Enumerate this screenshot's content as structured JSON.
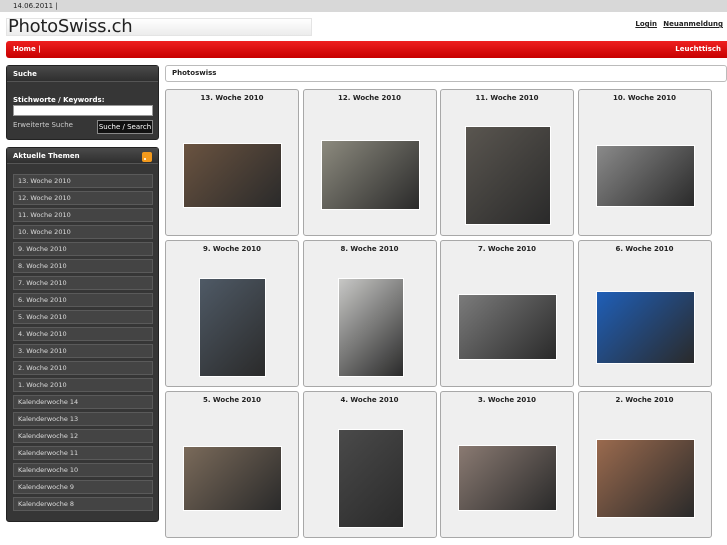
{
  "topbar": {
    "date": "14.06.2011 |"
  },
  "header": {
    "logo": "PhotoSwiss.ch",
    "login": "Login",
    "register": "Neuanmeldung"
  },
  "nav": {
    "home": "Home |",
    "lighttable": "Leuchttisch"
  },
  "search": {
    "title": "Suche",
    "label": "Stichworte / Keywords:",
    "input_value": "",
    "advanced": "Erweiterte Suche",
    "button": "Suche / Search"
  },
  "topics": {
    "title": "Aktuelle Themen",
    "items": [
      "13. Woche 2010",
      "12. Woche 2010",
      "11. Woche 2010",
      "10. Woche 2010",
      "9. Woche 2010",
      "8. Woche 2010",
      "7. Woche 2010",
      "6. Woche 2010",
      "5. Woche 2010",
      "4. Woche 2010",
      "3. Woche 2010",
      "2. Woche 2010",
      "1. Woche 2010",
      "Kalenderwoche 14",
      "Kalenderwoche 13",
      "Kalenderwoche 12",
      "Kalenderwoche 11",
      "Kalenderwoche 10",
      "Kalenderwoche 9",
      "Kalenderwoche 8"
    ]
  },
  "content": {
    "title": "Photoswiss",
    "cells": [
      {
        "title": "13. Woche 2010",
        "photo": "cathedral-ceremony",
        "color": "#6a5340"
      },
      {
        "title": "12. Woche 2010",
        "photo": "cyclists-street",
        "color": "#8c8a7e"
      },
      {
        "title": "11. Woche 2010",
        "photo": "man-in-office",
        "color": "#5a5650"
      },
      {
        "title": "10. Woche 2010",
        "photo": "tram-street-bw",
        "color": "#8a8a8a"
      },
      {
        "title": "9. Woche 2010",
        "photo": "woman-at-computer",
        "color": "#4f5a66"
      },
      {
        "title": "8. Woche 2010",
        "photo": "urinal",
        "color": "#c8c8c6"
      },
      {
        "title": "7. Woche 2010",
        "photo": "man-portrait",
        "color": "#7b7b7b"
      },
      {
        "title": "6. Woche 2010",
        "photo": "clouds-over-sea",
        "color": "#1f5fb8"
      },
      {
        "title": "5. Woche 2010",
        "photo": "city-night-aerial",
        "color": "#7a6a5a"
      },
      {
        "title": "4. Woche 2010",
        "photo": "man-in-hall",
        "color": "#4a4a4a"
      },
      {
        "title": "3. Woche 2010",
        "photo": "man-red-shirt",
        "color": "#8a7a72"
      },
      {
        "title": "2. Woche 2010",
        "photo": "market-scene",
        "color": "#9a6a4e"
      }
    ]
  }
}
